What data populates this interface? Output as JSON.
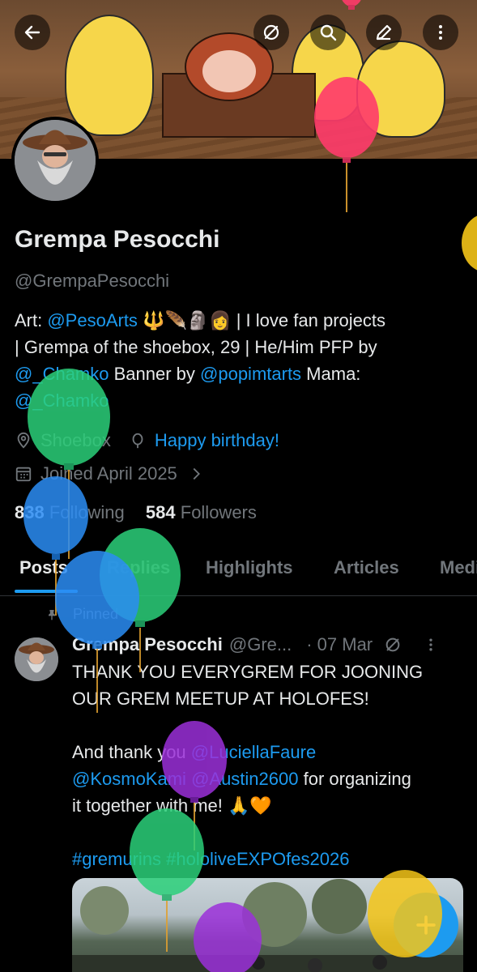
{
  "header": {
    "back_icon": "arrow-left-icon",
    "grok_icon": "slash-circle-icon",
    "search_icon": "search-icon",
    "edit_icon": "pencil-icon",
    "more_icon": "more-vertical-icon"
  },
  "profile": {
    "name": "Grempa Pesocchi",
    "handle": "@GrempaPesocchi",
    "bio": {
      "art_label": "Art: ",
      "art_link": "@PesoArts",
      "emojis": " 🔱🪶🗿👩 ",
      "line1_rest": "| I love fan projects",
      "line2": "| Grempa of the shoebox, 29 | He/Him PFP by",
      "pfp_link": "@_Chamko",
      "banner_label": " Banner by ",
      "banner_link": "@popimtarts",
      "mama_label": " Mama:",
      "mama_link": "@_Chamko"
    },
    "location": "Shoebox",
    "birthday": "Happy birthday!",
    "joined": "Joined April 2025",
    "following_count": "838",
    "following_label": "Following",
    "followers_count": "584",
    "followers_label": "Followers"
  },
  "tabs": [
    "Posts",
    "Replies",
    "Highlights",
    "Articles",
    "Media"
  ],
  "post": {
    "pinned_label": "Pinned",
    "author": "Grempa Pesocchi",
    "handle": "@Gre...",
    "date": "· 07 Mar",
    "line1": "THANK YOU EVERYGREM FOR JOONING",
    "line2": "OUR GREM MEETUP AT HOLOFES!",
    "thanks_label": "And thank you ",
    "mention1": "@LuciellaFaure",
    "mention2": "@KosmoKami",
    "mention3": "@Austin2600",
    "thanks_rest": " for organizing",
    "line5": "it together with me! 🙏🧡",
    "hashtag1": "#gremurins",
    "hashtag2": "#hololiveEXPOfes2026"
  },
  "colors": {
    "background": "#000000",
    "text_primary": "#e7e9ea",
    "text_secondary": "#71767b",
    "accent": "#1d9bf0"
  },
  "fab_icon": "plus-icon"
}
